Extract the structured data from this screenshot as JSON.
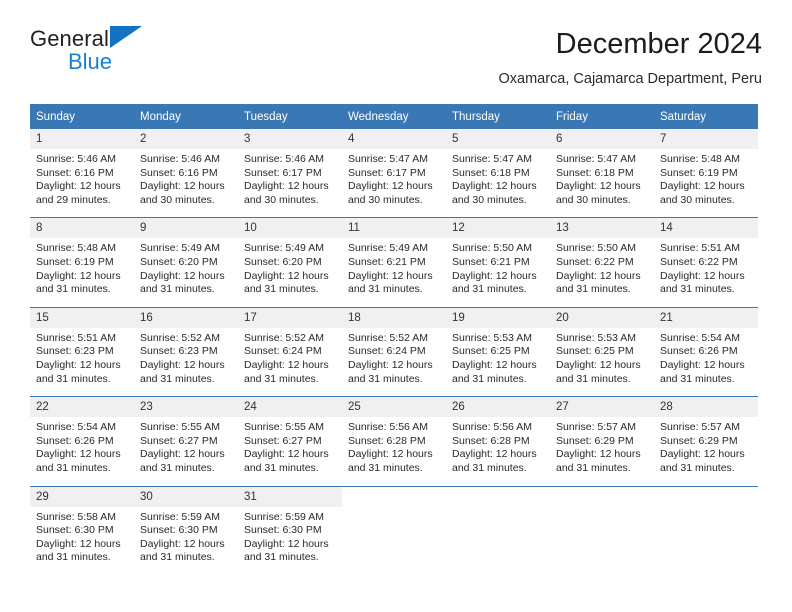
{
  "brand": {
    "line1": "General",
    "line2": "Blue"
  },
  "header": {
    "title": "December 2024",
    "subtitle": "Oxamarca, Cajamarca Department, Peru"
  },
  "colors": {
    "header_blue": "#3a78b5",
    "brand_blue": "#1b7fd4",
    "daynum_bg": "#f0f0f0"
  },
  "calendar": {
    "weekday_headers": [
      "Sunday",
      "Monday",
      "Tuesday",
      "Wednesday",
      "Thursday",
      "Friday",
      "Saturday"
    ],
    "weeks": [
      [
        {
          "day": "1",
          "sunrise": "Sunrise: 5:46 AM",
          "sunset": "Sunset: 6:16 PM",
          "daylight": "Daylight: 12 hours and 29 minutes."
        },
        {
          "day": "2",
          "sunrise": "Sunrise: 5:46 AM",
          "sunset": "Sunset: 6:16 PM",
          "daylight": "Daylight: 12 hours and 30 minutes."
        },
        {
          "day": "3",
          "sunrise": "Sunrise: 5:46 AM",
          "sunset": "Sunset: 6:17 PM",
          "daylight": "Daylight: 12 hours and 30 minutes."
        },
        {
          "day": "4",
          "sunrise": "Sunrise: 5:47 AM",
          "sunset": "Sunset: 6:17 PM",
          "daylight": "Daylight: 12 hours and 30 minutes."
        },
        {
          "day": "5",
          "sunrise": "Sunrise: 5:47 AM",
          "sunset": "Sunset: 6:18 PM",
          "daylight": "Daylight: 12 hours and 30 minutes."
        },
        {
          "day": "6",
          "sunrise": "Sunrise: 5:47 AM",
          "sunset": "Sunset: 6:18 PM",
          "daylight": "Daylight: 12 hours and 30 minutes."
        },
        {
          "day": "7",
          "sunrise": "Sunrise: 5:48 AM",
          "sunset": "Sunset: 6:19 PM",
          "daylight": "Daylight: 12 hours and 30 minutes."
        }
      ],
      [
        {
          "day": "8",
          "sunrise": "Sunrise: 5:48 AM",
          "sunset": "Sunset: 6:19 PM",
          "daylight": "Daylight: 12 hours and 31 minutes."
        },
        {
          "day": "9",
          "sunrise": "Sunrise: 5:49 AM",
          "sunset": "Sunset: 6:20 PM",
          "daylight": "Daylight: 12 hours and 31 minutes."
        },
        {
          "day": "10",
          "sunrise": "Sunrise: 5:49 AM",
          "sunset": "Sunset: 6:20 PM",
          "daylight": "Daylight: 12 hours and 31 minutes."
        },
        {
          "day": "11",
          "sunrise": "Sunrise: 5:49 AM",
          "sunset": "Sunset: 6:21 PM",
          "daylight": "Daylight: 12 hours and 31 minutes."
        },
        {
          "day": "12",
          "sunrise": "Sunrise: 5:50 AM",
          "sunset": "Sunset: 6:21 PM",
          "daylight": "Daylight: 12 hours and 31 minutes."
        },
        {
          "day": "13",
          "sunrise": "Sunrise: 5:50 AM",
          "sunset": "Sunset: 6:22 PM",
          "daylight": "Daylight: 12 hours and 31 minutes."
        },
        {
          "day": "14",
          "sunrise": "Sunrise: 5:51 AM",
          "sunset": "Sunset: 6:22 PM",
          "daylight": "Daylight: 12 hours and 31 minutes."
        }
      ],
      [
        {
          "day": "15",
          "sunrise": "Sunrise: 5:51 AM",
          "sunset": "Sunset: 6:23 PM",
          "daylight": "Daylight: 12 hours and 31 minutes."
        },
        {
          "day": "16",
          "sunrise": "Sunrise: 5:52 AM",
          "sunset": "Sunset: 6:23 PM",
          "daylight": "Daylight: 12 hours and 31 minutes."
        },
        {
          "day": "17",
          "sunrise": "Sunrise: 5:52 AM",
          "sunset": "Sunset: 6:24 PM",
          "daylight": "Daylight: 12 hours and 31 minutes."
        },
        {
          "day": "18",
          "sunrise": "Sunrise: 5:52 AM",
          "sunset": "Sunset: 6:24 PM",
          "daylight": "Daylight: 12 hours and 31 minutes."
        },
        {
          "day": "19",
          "sunrise": "Sunrise: 5:53 AM",
          "sunset": "Sunset: 6:25 PM",
          "daylight": "Daylight: 12 hours and 31 minutes."
        },
        {
          "day": "20",
          "sunrise": "Sunrise: 5:53 AM",
          "sunset": "Sunset: 6:25 PM",
          "daylight": "Daylight: 12 hours and 31 minutes."
        },
        {
          "day": "21",
          "sunrise": "Sunrise: 5:54 AM",
          "sunset": "Sunset: 6:26 PM",
          "daylight": "Daylight: 12 hours and 31 minutes."
        }
      ],
      [
        {
          "day": "22",
          "sunrise": "Sunrise: 5:54 AM",
          "sunset": "Sunset: 6:26 PM",
          "daylight": "Daylight: 12 hours and 31 minutes."
        },
        {
          "day": "23",
          "sunrise": "Sunrise: 5:55 AM",
          "sunset": "Sunset: 6:27 PM",
          "daylight": "Daylight: 12 hours and 31 minutes."
        },
        {
          "day": "24",
          "sunrise": "Sunrise: 5:55 AM",
          "sunset": "Sunset: 6:27 PM",
          "daylight": "Daylight: 12 hours and 31 minutes."
        },
        {
          "day": "25",
          "sunrise": "Sunrise: 5:56 AM",
          "sunset": "Sunset: 6:28 PM",
          "daylight": "Daylight: 12 hours and 31 minutes."
        },
        {
          "day": "26",
          "sunrise": "Sunrise: 5:56 AM",
          "sunset": "Sunset: 6:28 PM",
          "daylight": "Daylight: 12 hours and 31 minutes."
        },
        {
          "day": "27",
          "sunrise": "Sunrise: 5:57 AM",
          "sunset": "Sunset: 6:29 PM",
          "daylight": "Daylight: 12 hours and 31 minutes."
        },
        {
          "day": "28",
          "sunrise": "Sunrise: 5:57 AM",
          "sunset": "Sunset: 6:29 PM",
          "daylight": "Daylight: 12 hours and 31 minutes."
        }
      ],
      [
        {
          "day": "29",
          "sunrise": "Sunrise: 5:58 AM",
          "sunset": "Sunset: 6:30 PM",
          "daylight": "Daylight: 12 hours and 31 minutes."
        },
        {
          "day": "30",
          "sunrise": "Sunrise: 5:59 AM",
          "sunset": "Sunset: 6:30 PM",
          "daylight": "Daylight: 12 hours and 31 minutes."
        },
        {
          "day": "31",
          "sunrise": "Sunrise: 5:59 AM",
          "sunset": "Sunset: 6:30 PM",
          "daylight": "Daylight: 12 hours and 31 minutes."
        },
        {
          "day": "",
          "sunrise": "",
          "sunset": "",
          "daylight": ""
        },
        {
          "day": "",
          "sunrise": "",
          "sunset": "",
          "daylight": ""
        },
        {
          "day": "",
          "sunrise": "",
          "sunset": "",
          "daylight": ""
        },
        {
          "day": "",
          "sunrise": "",
          "sunset": "",
          "daylight": ""
        }
      ]
    ]
  }
}
